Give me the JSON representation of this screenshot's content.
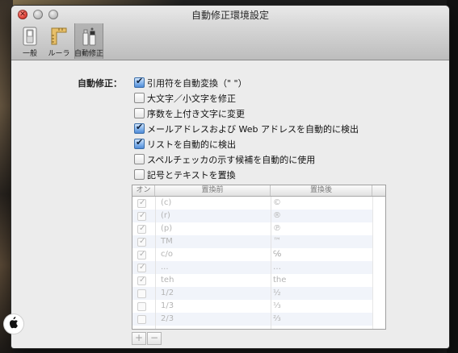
{
  "window": {
    "title": "自動修正環境設定"
  },
  "toolbar": {
    "items": [
      {
        "label": "一般",
        "icon": "switch-icon"
      },
      {
        "label": "ルーラ",
        "icon": "ruler-icon"
      },
      {
        "label": "自動修正",
        "icon": "spray-icon"
      }
    ],
    "selected": "自動修正"
  },
  "autocorrect": {
    "label": "自動修正：",
    "options": [
      {
        "label": "引用符を自動変換（\" \"）",
        "checked": true
      },
      {
        "label": "大文字／小文字を修正",
        "checked": false
      },
      {
        "label": "序数を上付き文字に変更",
        "checked": false
      },
      {
        "label": "メールアドレスおよび Web アドレスを自動的に検出",
        "checked": true
      },
      {
        "label": "リストを自動的に検出",
        "checked": true
      },
      {
        "label": "スペルチェッカの示す候補を自動的に使用",
        "checked": false
      },
      {
        "label": "記号とテキストを置換",
        "checked": false
      }
    ]
  },
  "table": {
    "headers": [
      "オン",
      "置換前",
      "置換後"
    ],
    "rows": [
      {
        "on": true,
        "before": "(c)",
        "after": "©"
      },
      {
        "on": true,
        "before": "(r)",
        "after": "®"
      },
      {
        "on": true,
        "before": "(p)",
        "after": "℗"
      },
      {
        "on": true,
        "before": "TM",
        "after": "™"
      },
      {
        "on": true,
        "before": "c/o",
        "after": "℅"
      },
      {
        "on": true,
        "before": "...",
        "after": "…"
      },
      {
        "on": true,
        "before": "teh",
        "after": "the"
      },
      {
        "on": false,
        "before": "1/2",
        "after": "½"
      },
      {
        "on": false,
        "before": "1/3",
        "after": "⅓"
      },
      {
        "on": false,
        "before": "2/3",
        "after": "⅔"
      }
    ]
  },
  "buttons": {
    "add": "+",
    "remove": "−"
  }
}
